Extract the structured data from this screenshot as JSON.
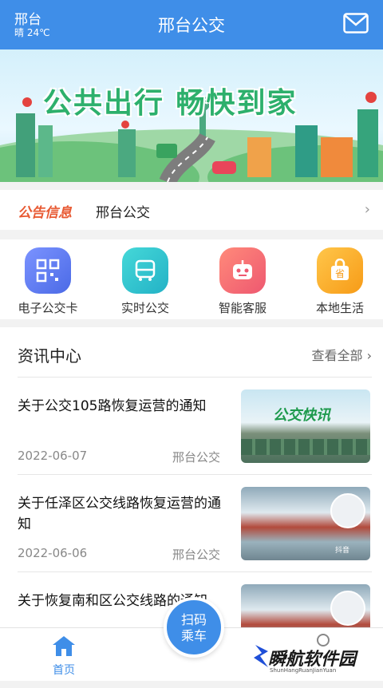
{
  "header": {
    "city": "邢台",
    "weather": "晴 24℃",
    "title": "邢台公交",
    "mail_icon": "mail-icon"
  },
  "banner": {
    "slogan": "公共出行  畅快到家"
  },
  "notice": {
    "tag": "公告信息",
    "text": "邢台公交",
    "arrow": "›"
  },
  "quick": [
    {
      "label": "电子公交卡",
      "icon": "qr-card-icon",
      "color": "#5b7cf0"
    },
    {
      "label": "实时公交",
      "icon": "bus-icon",
      "color": "#2fc4cf"
    },
    {
      "label": "智能客服",
      "icon": "robot-icon",
      "color": "#f46a6a"
    },
    {
      "label": "本地生活",
      "icon": "shopping-bag-icon",
      "color": "#f7a21c"
    }
  ],
  "news": {
    "title": "资讯中心",
    "more": "查看全部 ›",
    "articles": [
      {
        "title": "关于公交105路恢复运营的通知",
        "date": "2022-06-07",
        "source": "邢台公交",
        "image_text": "公交快讯"
      },
      {
        "title": "关于任泽区公交线路恢复运营的通知",
        "date": "2022-06-06",
        "source": "邢台公交",
        "image_text": "抖音"
      },
      {
        "title": "关于恢复南和区公交线路的通知",
        "date": "",
        "source": "",
        "image_text": ""
      }
    ]
  },
  "tabbar": {
    "home": "首页",
    "scan": "扫码\n乘车"
  },
  "watermark": {
    "text": "瞬航软件园",
    "sub": "ShunHangRuanJianYuan"
  }
}
